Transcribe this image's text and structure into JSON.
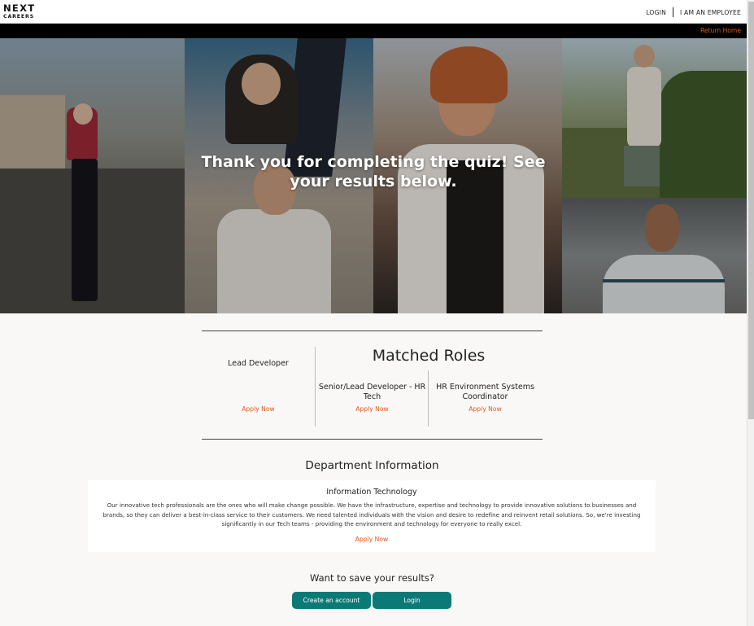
{
  "nav": {
    "logo_line1": "NEXT",
    "logo_line2": "CAREERS",
    "login": "LOGIN",
    "employee": "I AM AN EMPLOYEE",
    "return_home": "Return Home"
  },
  "hero": {
    "title": "Thank you for completing the quiz! See your results below."
  },
  "roles": {
    "title": "Matched Roles",
    "items": [
      {
        "name": "Lead Developer",
        "apply": "Apply Now"
      },
      {
        "name": "Senior/Lead Developer - HR Tech",
        "apply": "Apply Now"
      },
      {
        "name": "HR Environment Systems Coordinator",
        "apply": "Apply Now"
      }
    ]
  },
  "department": {
    "title": "Department Information",
    "name": "Information Technology",
    "description": "Our innovative tech professionals are the ones who will make change possible. We have the infrastructure, expertise and technology to provide innovative solutions to businesses and brands, so they can deliver a best-in-class service to their customers. We need talented individuals with the vision and desire to redefine and reinvent retail solutions. So, we're investing significantly in our Tech teams - providing the environment and technology for everyone to really excel.",
    "apply": "Apply Now"
  },
  "save": {
    "title": "Want to save your results?",
    "create_account": "Create an account",
    "login": "Login"
  },
  "colors": {
    "accent_orange": "#e05a1c",
    "button_teal": "#0b7a76",
    "page_bg": "#f9f8f6"
  }
}
